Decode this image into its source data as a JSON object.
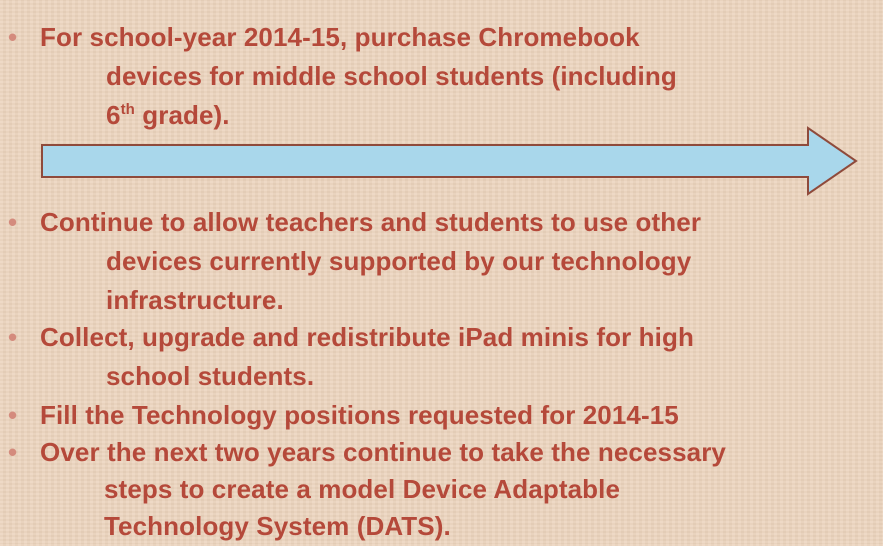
{
  "bullets": [
    {
      "lines": [
        "For school-year 2014-15, purchase Chromebook",
        "devices for middle school students (including",
        "6",
        "th",
        " grade)."
      ]
    },
    {
      "lines": [
        "Continue to allow teachers and students to use other",
        "devices currently supported by our technology",
        "infrastructure."
      ]
    },
    {
      "lines": [
        "Collect, upgrade and redistribute iPad minis for high",
        "school students."
      ]
    },
    {
      "lines": [
        "Fill the Technology positions requested for 2014-15"
      ]
    },
    {
      "lines": [
        "Over the next two years continue to take the necessary",
        "steps to create a model Device Adaptable",
        "Technology  System (DATS)."
      ]
    }
  ],
  "bullet_symbol": "•",
  "colors": {
    "text": "#b5493a",
    "bullet": "#d48b7d",
    "background": "#ecd3bd",
    "arrow_fill": "#a9d7eb",
    "arrow_stroke": "#8f4a3b"
  }
}
